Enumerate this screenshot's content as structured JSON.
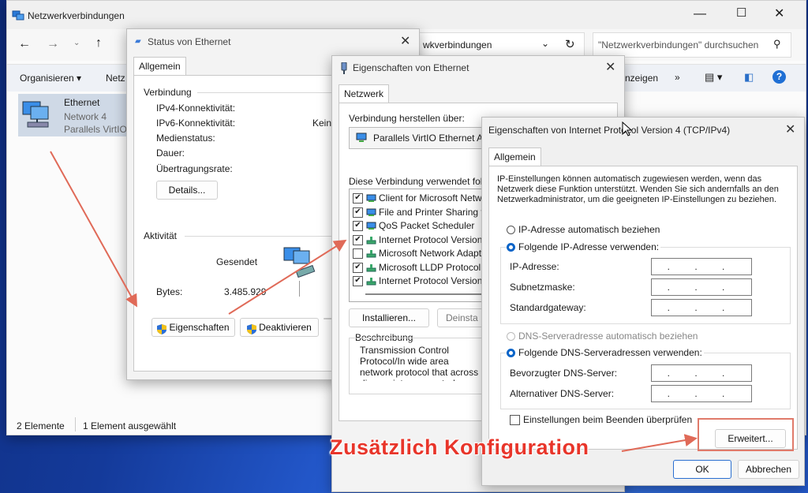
{
  "explorer": {
    "title": "Netzwerkverbindungen",
    "address": "wkverbindungen",
    "search_placeholder": "\"Netzwerkverbindungen\" durchsuchen",
    "organize": "Organisieren",
    "netz": "Netz",
    "view_label": "nzeigen",
    "more": "»",
    "item": {
      "name": "Ethernet",
      "network": "Network 4",
      "adapter": "Parallels VirtIO"
    },
    "status": {
      "count": "2 Elemente",
      "selected": "1 Element ausgewählt"
    }
  },
  "status_dialog": {
    "title": "Status von Ethernet",
    "tab": "Allgemein",
    "connection_header": "Verbindung",
    "ipv4": "IPv4-Konnektivität:",
    "ipv6": "IPv6-Konnektivität:",
    "ipv6_value": "Kein",
    "media": "Medienstatus:",
    "duration": "Dauer:",
    "rate": "Übertragungsrate:",
    "details_btn": "Details...",
    "activity_header": "Aktivität",
    "sent": "Gesendet",
    "bytes_label": "Bytes:",
    "bytes_value": "3.485.929",
    "properties_btn": "Eigenschaften",
    "disable_btn": "Deaktivieren"
  },
  "eth_props": {
    "title": "Eigenschaften von Ethernet",
    "tab": "Netzwerk",
    "connect_using": "Verbindung herstellen über:",
    "adapter": "Parallels VirtIO Ethernet Ada",
    "uses_label": "Diese Verbindung verwendet folge",
    "items": [
      {
        "label": "Client for Microsoft Netwo",
        "checked": true
      },
      {
        "label": "File and Printer Sharing fo",
        "checked": true
      },
      {
        "label": "QoS Packet Scheduler",
        "checked": true
      },
      {
        "label": "Internet Protocol Version 4",
        "checked": true
      },
      {
        "label": "Microsoft Network Adapte",
        "checked": false
      },
      {
        "label": "Microsoft LLDP Protocol D",
        "checked": true
      },
      {
        "label": "Internet Protocol Version 6",
        "checked": true
      }
    ],
    "install_btn": "Installieren...",
    "uninstall_btn": "Deinsta",
    "description_header": "Beschreibung",
    "description": "Transmission Control Protocol/In wide area network protocol that across diverse interconnected n"
  },
  "ipv4_props": {
    "title": "Eigenschaften von Internet Protocol Version 4 (TCP/IPv4)",
    "tab": "Allgemein",
    "intro": "IP-Einstellungen können automatisch zugewiesen werden, wenn das Netzwerk diese Funktion unterstützt. Wenden Sie sich andernfalls an den Netzwerkadministrator, um die geeigneten IP-Einstellungen zu beziehen.",
    "auto_ip": "IP-Adresse automatisch beziehen",
    "manual_ip": "Folgende IP-Adresse verwenden:",
    "ip_label": "IP-Adresse:",
    "mask_label": "Subnetzmaske:",
    "gateway_label": "Standardgateway:",
    "auto_dns": "DNS-Serveradresse automatisch beziehen",
    "manual_dns": "Folgende DNS-Serveradressen verwenden:",
    "pref_dns": "Bevorzugter DNS-Server:",
    "alt_dns": "Alternativer DNS-Server:",
    "ip_placeholder": ". . .",
    "validate": "Einstellungen beim Beenden überprüfen",
    "advanced_btn": "Erweitert...",
    "ok_btn": "OK",
    "cancel_btn": "Abbrechen"
  },
  "annotation": {
    "text": "Zusätzlich Konfiguration",
    "color": "#e8352a"
  }
}
